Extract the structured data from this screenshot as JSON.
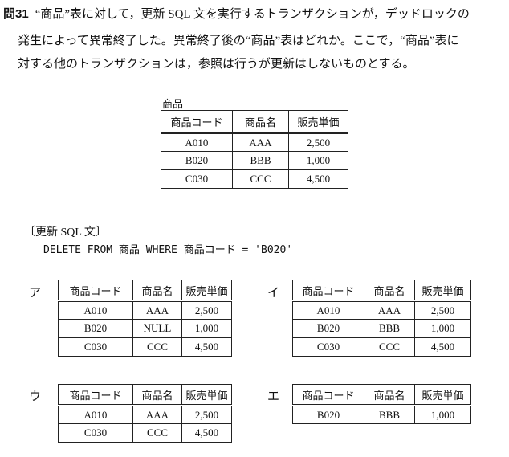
{
  "question": {
    "number": "問31",
    "lines": [
      "“商品”表に対して，更新 SQL 文を実行するトランザクションが，デッドロックの",
      "発生によって異常終了した。異常終了後の“商品”表はどれか。ここで，“商品”表に",
      "対する他のトランザクションは，参照は行うが更新はしないものとする。"
    ]
  },
  "table": {
    "caption": "商品",
    "headers": [
      "商品コード",
      "商品名",
      "販売単価"
    ],
    "rows": [
      [
        "A010",
        "AAA",
        "2,500"
      ],
      [
        "B020",
        "BBB",
        "1,000"
      ],
      [
        "C030",
        "CCC",
        "4,500"
      ]
    ]
  },
  "sql": {
    "label": "〔更新 SQL 文〕",
    "statement": "DELETE FROM 商品 WHERE 商品コード = 'B020'"
  },
  "options": [
    {
      "label": "ア",
      "headers": [
        "商品コード",
        "商品名",
        "販売単価"
      ],
      "rows": [
        [
          "A010",
          "AAA",
          "2,500"
        ],
        [
          "B020",
          "NULL",
          "1,000"
        ],
        [
          "C030",
          "CCC",
          "4,500"
        ]
      ]
    },
    {
      "label": "イ",
      "headers": [
        "商品コード",
        "商品名",
        "販売単価"
      ],
      "rows": [
        [
          "A010",
          "AAA",
          "2,500"
        ],
        [
          "B020",
          "BBB",
          "1,000"
        ],
        [
          "C030",
          "CCC",
          "4,500"
        ]
      ]
    },
    {
      "label": "ウ",
      "headers": [
        "商品コード",
        "商品名",
        "販売単価"
      ],
      "rows": [
        [
          "A010",
          "AAA",
          "2,500"
        ],
        [
          "C030",
          "CCC",
          "4,500"
        ]
      ]
    },
    {
      "label": "エ",
      "headers": [
        "商品コード",
        "商品名",
        "販売単価"
      ],
      "rows": [
        [
          "B020",
          "BBB",
          "1,000"
        ]
      ]
    }
  ]
}
